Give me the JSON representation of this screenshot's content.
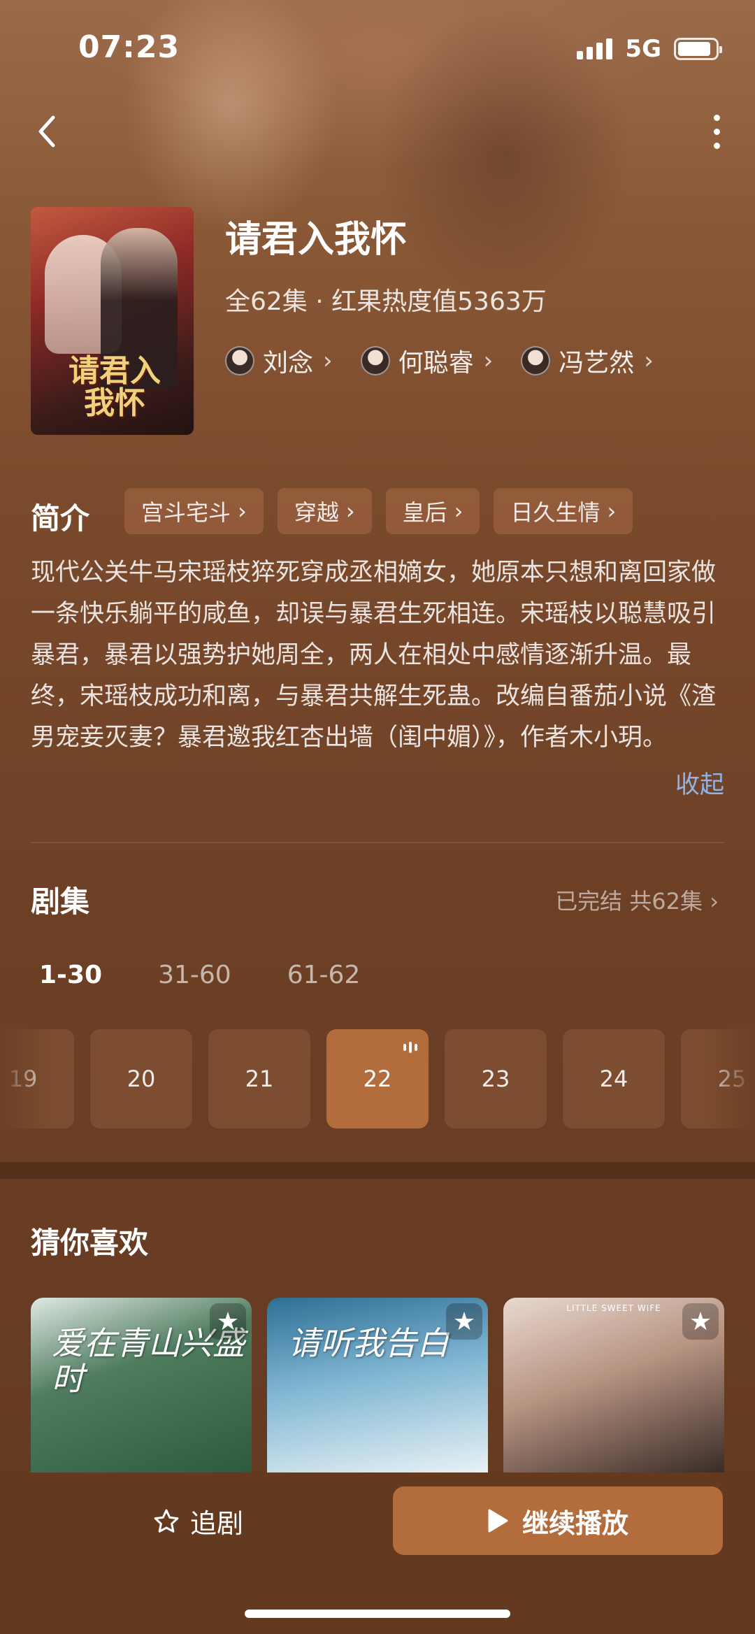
{
  "status_bar": {
    "time": "07:23",
    "network": "5G",
    "battery_percent": 88
  },
  "drama": {
    "title": "请君入我怀",
    "meta": "全62集 · 红果热度值5363万",
    "poster_title": "请君入我怀",
    "cast": [
      {
        "name": "刘念"
      },
      {
        "name": "何聪睿"
      },
      {
        "name": "冯艺然"
      }
    ]
  },
  "intro": {
    "label": "简介",
    "tags": [
      "宫斗宅斗",
      "穿越",
      "皇后",
      "日久生情"
    ],
    "description": "现代公关牛马宋瑶枝猝死穿成丞相嫡女，她原本只想和离回家做一条快乐躺平的咸鱼，却误与暴君生死相连。宋瑶枝以聪慧吸引暴君，暴君以强势护她周全，两人在相处中感情逐渐升温。最终，宋瑶枝成功和离，与暴君共解生死蛊。改编自番茄小说《渣男宠妾灭妻？暴君邀我红杏出墙（闺中媚）》，作者木小玥。",
    "collapse_label": "收起"
  },
  "episodes": {
    "label": "剧集",
    "status": "已完结 共62集",
    "ranges": [
      "1-30",
      "31-60",
      "61-62"
    ],
    "active_range": 0,
    "items": [
      "19",
      "20",
      "21",
      "22",
      "23",
      "24",
      "25"
    ],
    "current": "22"
  },
  "recommendations": {
    "label": "猜你喜欢",
    "cards": [
      {
        "title": "爱在青山兴盛时",
        "sub": ""
      },
      {
        "title": "请听我告白",
        "sub": ""
      },
      {
        "title": "",
        "sub": "LITTLE SWEET WIFE"
      }
    ]
  },
  "actions": {
    "follow_label": "追剧",
    "play_label": "继续播放"
  },
  "colors": {
    "accent": "#b36c3b",
    "background": "#6a3d22",
    "link": "#8fb3e6"
  }
}
